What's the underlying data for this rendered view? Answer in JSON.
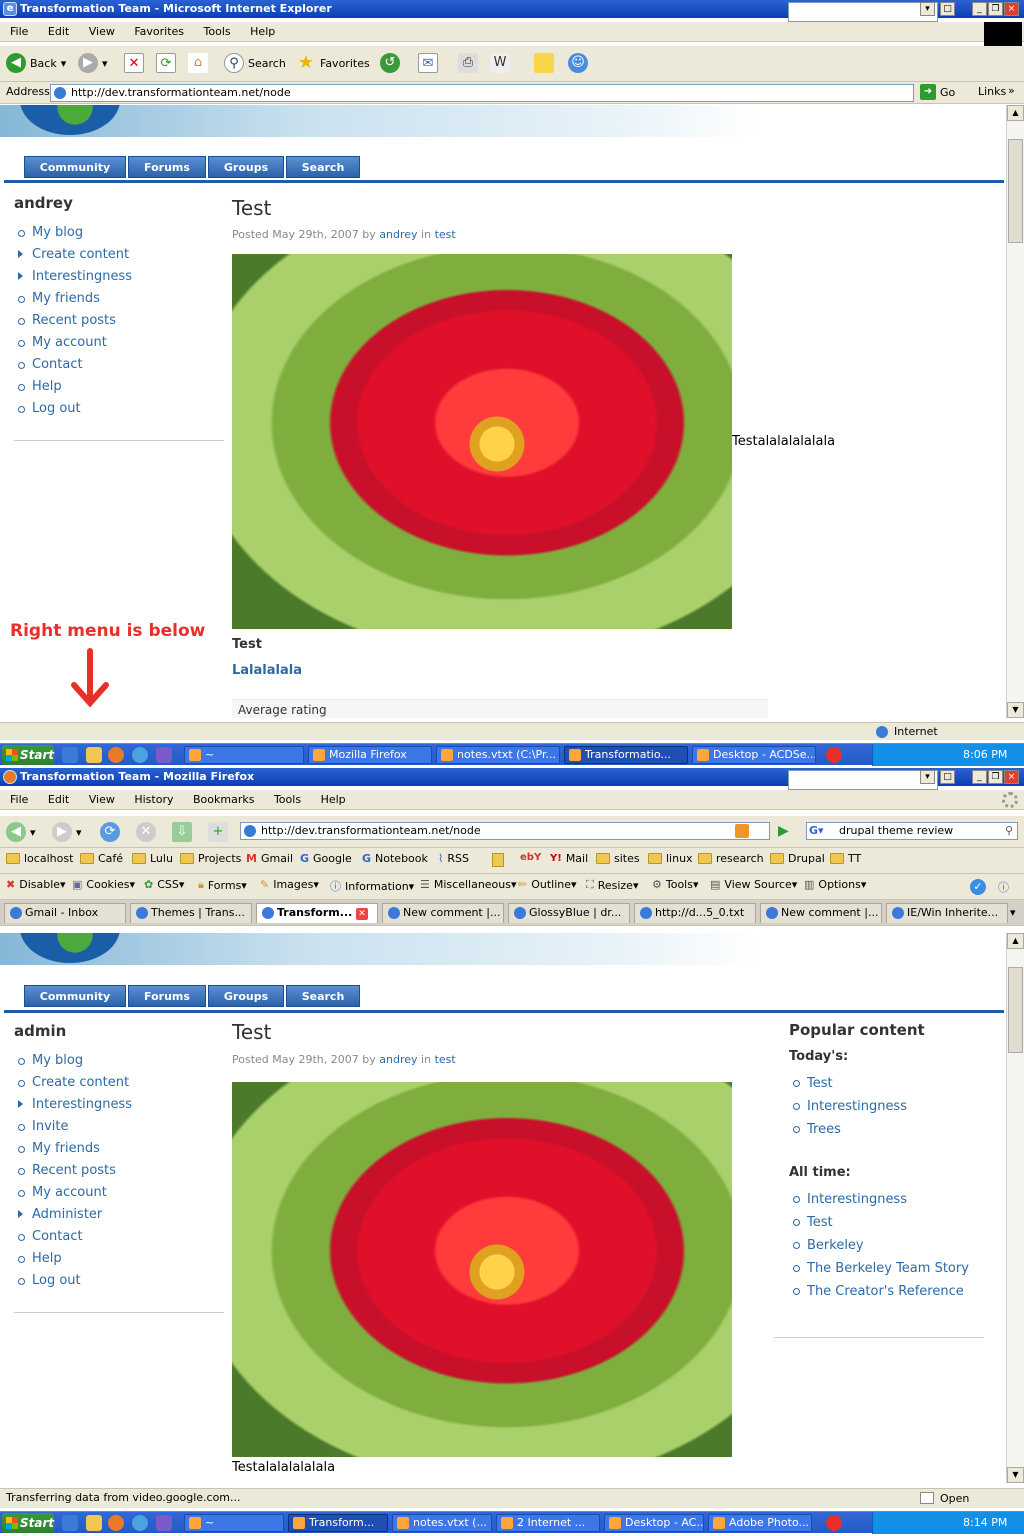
{
  "ie": {
    "title": "Transformation Team - Microsoft Internet Explorer",
    "menu": [
      "File",
      "Edit",
      "View",
      "Favorites",
      "Tools",
      "Help"
    ],
    "toolbar": {
      "back": "Back",
      "search": "Search",
      "favorites": "Favorites"
    },
    "address_label": "Address",
    "url": "http://dev.transformationteam.net/node",
    "go": "Go",
    "links": "Links",
    "zone": "Internet",
    "sidebar": {
      "user": "andrey",
      "items": [
        "My blog",
        "Create content",
        "Interestingness",
        "My friends",
        "Recent posts",
        "My account",
        "Contact",
        "Help",
        "Log out"
      ]
    },
    "annotation": "Right menu is below",
    "side_text": "Testalalalalalala",
    "rating_label": "Average rating",
    "taskbar": {
      "start": "Start",
      "tasks": [
        "~",
        "Mozilla Firefox",
        "notes.vtxt (C:\\Pr...",
        "Transformatio...",
        "Desktop - ACDSe..."
      ],
      "clock": "8:06 PM"
    }
  },
  "site": {
    "nav": [
      "Community",
      "Forums",
      "Groups",
      "Search"
    ],
    "node": {
      "title": "Test",
      "posted": "Posted May 29th, 2007 by",
      "author": "andrey",
      "in": "in",
      "term": "test",
      "body_title": "Test",
      "body_link": "Lalalalala"
    }
  },
  "ff": {
    "title": "Transformation Team - Mozilla Firefox",
    "menu": [
      "File",
      "Edit",
      "View",
      "History",
      "Bookmarks",
      "Tools",
      "Help"
    ],
    "url": "http://dev.transformationteam.net/node",
    "search_value": "drupal theme review",
    "bookmarks": [
      "localhost",
      "Café",
      "Lulu",
      "Projects",
      "Gmail",
      "Google",
      "Notebook",
      "RSS",
      "Mail",
      "sites",
      "linux",
      "research",
      "Drupal",
      "TT"
    ],
    "webdev": [
      "Disable▾",
      "Cookies▾",
      "CSS▾",
      "Forms▾",
      "Images▾",
      "Information▾",
      "Miscellaneous▾",
      "Outline▾",
      "Resize▾",
      "Tools▾",
      "View Source▾",
      "Options▾"
    ],
    "tabs": [
      "Gmail - Inbox",
      "Themes | Trans...",
      "Transform...",
      "New comment |...",
      "GlossyBlue | dr...",
      "http://d...5_0.txt",
      "New comment |...",
      "IE/Win Inherite..."
    ],
    "sidebar": {
      "user": "admin",
      "items": [
        "My blog",
        "Create content",
        "Interestingness",
        "Invite",
        "My friends",
        "Recent posts",
        "My account",
        "Administer",
        "Contact",
        "Help",
        "Log out"
      ]
    },
    "popular": {
      "title": "Popular content",
      "today_label": "Today's:",
      "today": [
        "Test",
        "Interestingness",
        "Trees"
      ],
      "alltime_label": "All time:",
      "alltime": [
        "Interestingness",
        "Test",
        "Berkeley",
        "The Berkeley Team Story",
        "The Creator's Reference"
      ]
    },
    "caption": "Testalalalalalala",
    "status": "Transferring data from video.google.com...",
    "status_right": "Open Notebook",
    "taskbar": {
      "start": "Start",
      "tasks": [
        "~",
        "Transform...",
        "notes.vtxt (...",
        "2 Internet ...",
        "Desktop - AC...",
        "Adobe Photo..."
      ],
      "clock": "8:14 PM"
    }
  }
}
